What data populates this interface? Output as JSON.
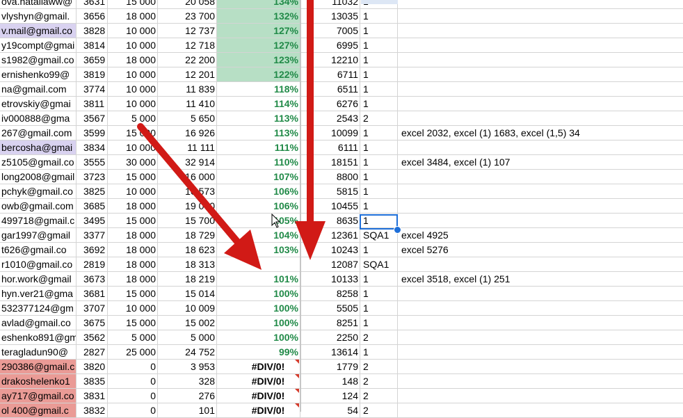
{
  "sheet": {
    "rows": [
      {
        "email": "ova.nataliaww@",
        "id": "3631",
        "plan": "15 000",
        "fact": "20 058",
        "pct": "134%",
        "num": "11032",
        "flag": "1",
        "note": "",
        "email_bg": "",
        "pct_bg": "green"
      },
      {
        "email": "vlyshyn@gmail.",
        "id": "3656",
        "plan": "18 000",
        "fact": "23 700",
        "pct": "132%",
        "num": "13035",
        "flag": "1",
        "note": "",
        "email_bg": "",
        "pct_bg": "green"
      },
      {
        "email": "v.mail@gmail.co",
        "id": "3828",
        "plan": "10 000",
        "fact": "12 737",
        "pct": "127%",
        "num": "7005",
        "flag": "1",
        "note": "",
        "email_bg": "purple",
        "pct_bg": "green"
      },
      {
        "email": "y19compt@gmai",
        "id": "3814",
        "plan": "10 000",
        "fact": "12 718",
        "pct": "127%",
        "num": "6995",
        "flag": "1",
        "note": "",
        "email_bg": "",
        "pct_bg": "green"
      },
      {
        "email": "s1982@gmail.co",
        "id": "3659",
        "plan": "18 000",
        "fact": "22 200",
        "pct": "123%",
        "num": "12210",
        "flag": "1",
        "note": "",
        "email_bg": "",
        "pct_bg": "green"
      },
      {
        "email": "ernishenko99@",
        "id": "3819",
        "plan": "10 000",
        "fact": "12 201",
        "pct": "122%",
        "num": "6711",
        "flag": "1",
        "note": "",
        "email_bg": "",
        "pct_bg": "green"
      },
      {
        "email": "na@gmail.com",
        "id": "3774",
        "plan": "10 000",
        "fact": "11 839",
        "pct": "118%",
        "num": "6511",
        "flag": "1",
        "note": "",
        "email_bg": "",
        "pct_bg": ""
      },
      {
        "email": "etrovskiy@gmai",
        "id": "3811",
        "plan": "10 000",
        "fact": "11 410",
        "pct": "114%",
        "num": "6276",
        "flag": "1",
        "note": "",
        "email_bg": "",
        "pct_bg": ""
      },
      {
        "email": "iv000888@gma",
        "id": "3567",
        "plan": "5 000",
        "fact": "5 650",
        "pct": "113%",
        "num": "2543",
        "flag": "2",
        "note": "",
        "email_bg": "",
        "pct_bg": ""
      },
      {
        "email": "267@gmail.com",
        "id": "3599",
        "plan": "15 000",
        "fact": "16 926",
        "pct": "113%",
        "num": "10099",
        "flag": "1",
        "note": "excel 2032, excel (1) 1683, excel (1,5) 34",
        "email_bg": "",
        "pct_bg": ""
      },
      {
        "email": "bercosha@gmai",
        "id": "3834",
        "plan": "10 000",
        "fact": "11 111",
        "pct": "111%",
        "num": "6111",
        "flag": "1",
        "note": "",
        "email_bg": "purple",
        "pct_bg": ""
      },
      {
        "email": "z5105@gmail.co",
        "id": "3555",
        "plan": "30 000",
        "fact": "32 914",
        "pct": "110%",
        "num": "18151",
        "flag": "1",
        "note": "excel 3484, excel (1) 107",
        "email_bg": "",
        "pct_bg": ""
      },
      {
        "email": "long2008@gmail",
        "id": "3723",
        "plan": "15 000",
        "fact": "16 000",
        "pct": "107%",
        "num": "8800",
        "flag": "1",
        "note": "",
        "email_bg": "",
        "pct_bg": ""
      },
      {
        "email": "pchyk@gmail.co",
        "id": "3825",
        "plan": "10 000",
        "fact": "10 573",
        "pct": "106%",
        "num": "5815",
        "flag": "1",
        "note": "",
        "email_bg": "",
        "pct_bg": ""
      },
      {
        "email": "owb@gmail.com",
        "id": "3685",
        "plan": "18 000",
        "fact": "19 000",
        "pct": "106%",
        "num": "10455",
        "flag": "1",
        "note": "",
        "email_bg": "",
        "pct_bg": ""
      },
      {
        "email": "499718@gmail.c",
        "id": "3495",
        "plan": "15 000",
        "fact": "15 700",
        "pct": "105%",
        "num": "8635",
        "flag": "1",
        "note": "",
        "email_bg": "",
        "pct_bg": ""
      },
      {
        "email": "gar1997@gmail",
        "id": "3377",
        "plan": "18 000",
        "fact": "18 729",
        "pct": "104%",
        "num": "12361",
        "flag": "SQA1",
        "note": "excel 4925",
        "email_bg": "",
        "pct_bg": ""
      },
      {
        "email": "t626@gmail.co",
        "id": "3692",
        "plan": "18 000",
        "fact": "18 623",
        "pct": "103%",
        "num": "10243",
        "flag": "1",
        "note": "excel 5276",
        "email_bg": "",
        "pct_bg": ""
      },
      {
        "email": "r1010@gmail.co",
        "id": "2819",
        "plan": "18 000",
        "fact": "18 313",
        "pct": "",
        "num": "12087",
        "flag": "SQA1",
        "note": "",
        "email_bg": "",
        "pct_bg": ""
      },
      {
        "email": "hor.work@gmail",
        "id": "3673",
        "plan": "18 000",
        "fact": "18 219",
        "pct": "101%",
        "num": "10133",
        "flag": "1",
        "note": "excel 3518, excel (1) 251",
        "email_bg": "",
        "pct_bg": ""
      },
      {
        "email": "hyn.ver21@gma",
        "id": "3681",
        "plan": "15 000",
        "fact": "15 014",
        "pct": "100%",
        "num": "8258",
        "flag": "1",
        "note": "",
        "email_bg": "",
        "pct_bg": ""
      },
      {
        "email": "532377124@gm",
        "id": "3707",
        "plan": "10 000",
        "fact": "10 009",
        "pct": "100%",
        "num": "5505",
        "flag": "1",
        "note": "",
        "email_bg": "",
        "pct_bg": ""
      },
      {
        "email": "avlad@gmail.co",
        "id": "3675",
        "plan": "15 000",
        "fact": "15 002",
        "pct": "100%",
        "num": "8251",
        "flag": "1",
        "note": "",
        "email_bg": "",
        "pct_bg": ""
      },
      {
        "email": "eshenko891@gm",
        "id": "3562",
        "plan": "5 000",
        "fact": "5 000",
        "pct": "100%",
        "num": "2250",
        "flag": "2",
        "note": "",
        "email_bg": "",
        "pct_bg": ""
      },
      {
        "email": "teragladun90@",
        "id": "2827",
        "plan": "25 000",
        "fact": "24 752",
        "pct": "99%",
        "num": "13614",
        "flag": "1",
        "note": "",
        "email_bg": "",
        "pct_bg": ""
      },
      {
        "email": "290386@gmail.c",
        "id": "3820",
        "plan": "0",
        "fact": "3 953",
        "pct": "#DIV/0!",
        "num": "1779",
        "flag": "2",
        "note": "",
        "email_bg": "red",
        "pct_bg": "",
        "error": true
      },
      {
        "email": "drakoshelenko1",
        "id": "3835",
        "plan": "0",
        "fact": "328",
        "pct": "#DIV/0!",
        "num": "148",
        "flag": "2",
        "note": "",
        "email_bg": "red",
        "pct_bg": "",
        "error": true
      },
      {
        "email": "ay717@gmail.co",
        "id": "3831",
        "plan": "0",
        "fact": "276",
        "pct": "#DIV/0!",
        "num": "124",
        "flag": "2",
        "note": "",
        "email_bg": "red",
        "pct_bg": "",
        "error": true
      },
      {
        "email": "ol 400@gmail.c",
        "id": "3832",
        "plan": "0",
        "fact": "101",
        "pct": "#DIV/0!",
        "num": "54",
        "flag": "2",
        "note": "",
        "email_bg": "red",
        "pct_bg": "",
        "error": true
      }
    ],
    "colors": {
      "pct_text": "#218a48",
      "pct_highlight": "#b7dfc5",
      "email_purple": "#d9d2f0",
      "email_red": "#ea9b96",
      "selection": "#1e6fd9",
      "arrow": "#d11a16"
    },
    "selected_cell_value": "1"
  }
}
